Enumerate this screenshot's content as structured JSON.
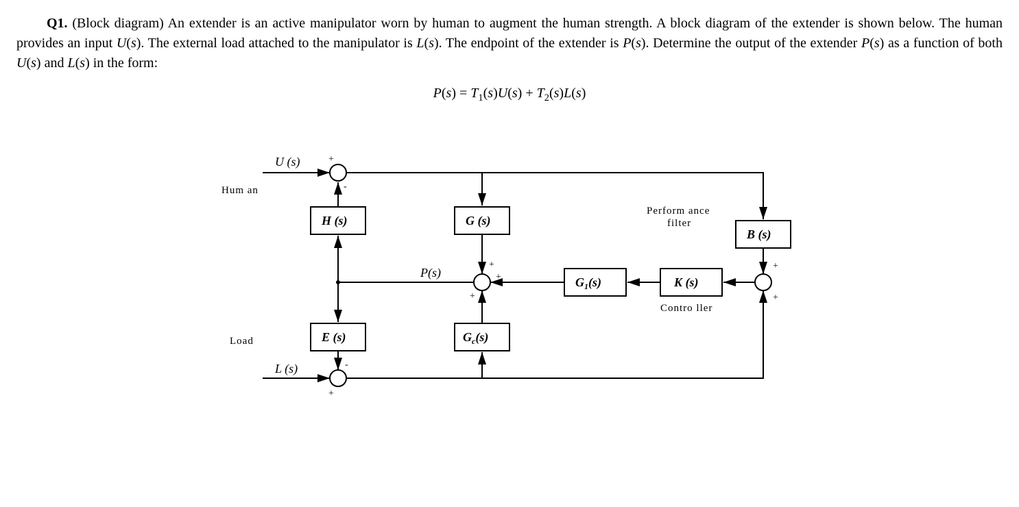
{
  "question_id": "Q1.",
  "question_topic": "(Block diagram)",
  "body_text": "An extender is an active manipulator worn by human to augment the human strength. A block diagram of the extender is shown below. The human provides an input U(s). The external load attached to the manipulator is L(s). The endpoint of the extender is P(s). Determine the output of the extender P(s) as a function of both U(s) and L(s) in the form:",
  "equation_plain": "P(s) = T1(s)U(s) + T2(s)L(s)",
  "labels": {
    "human": "Hum an",
    "load": "Load",
    "perf_filter_l1": "Perform ance",
    "perf_filter_l2": "filter",
    "controller": "Contro ller",
    "U": "U (s)",
    "L": "L (s)",
    "P": "P(s)"
  },
  "blocks": {
    "H": "H (s)",
    "G": "G (s)",
    "B": "B (s)",
    "G1_name": "G",
    "G1_sub": "1",
    "G1_tail": "(s)",
    "K": "K (s)",
    "E": "E (s)",
    "Gc_name": "G",
    "Gc_sub": "c",
    "Gc_tail": "(s)"
  },
  "signs": {
    "plus": "+",
    "minus": "-"
  }
}
